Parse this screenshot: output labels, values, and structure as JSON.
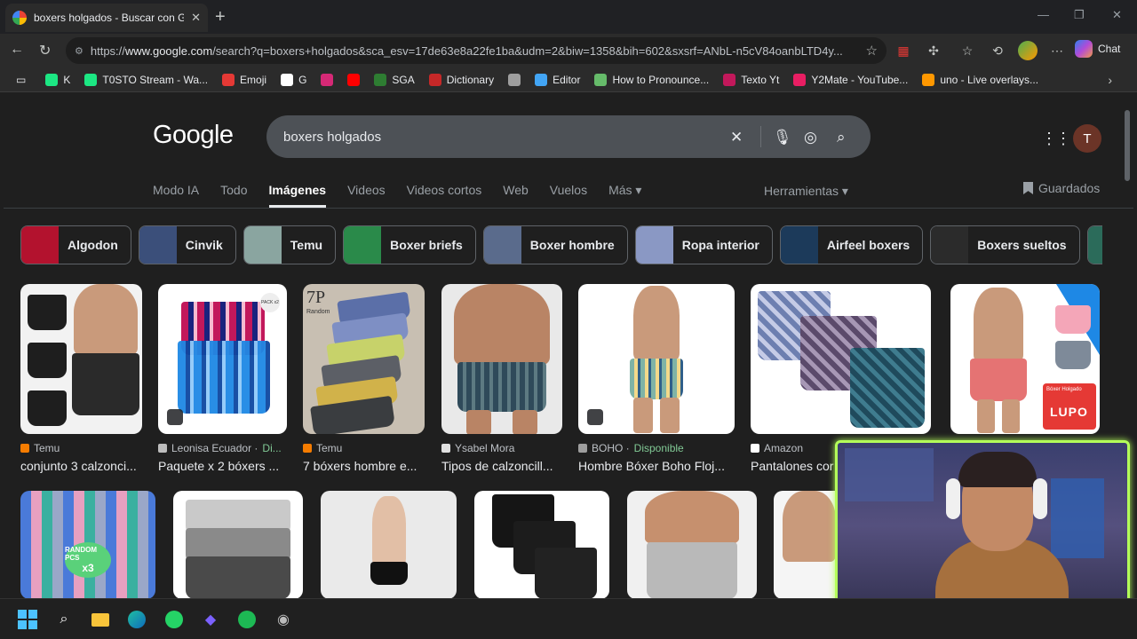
{
  "browser": {
    "tab_title": "boxers holgados - Buscar con Goo",
    "url_prefix": "https://",
    "url_host": "www.google.com",
    "url_rest": "/search?q=boxers+holgados&sca_esv=17de63e8a22fe1ba&udm=2&biw=1358&bih=602&sxsrf=ANbL-n5cV84oanbLTD4y...",
    "chat_label": "Chat"
  },
  "bookmarks": [
    {
      "label": "K",
      "color": "#1ce783"
    },
    {
      "label": "T0STO Stream - Wa...",
      "color": "#1ce783"
    },
    {
      "label": "Emoji",
      "color": "#e53935"
    },
    {
      "label": "G",
      "color": "#ffffff"
    },
    {
      "label": "",
      "color": "#d62976"
    },
    {
      "label": "",
      "color": "#ff0000"
    },
    {
      "label": "SGA",
      "color": "#2e7d32"
    },
    {
      "label": "Dictionary",
      "color": "#c62828"
    },
    {
      "label": "",
      "color": "#9e9e9e"
    },
    {
      "label": "Editor",
      "color": "#42a5f5"
    },
    {
      "label": "How to Pronounce...",
      "color": "#66bb6a"
    },
    {
      "label": "Texto Yt",
      "color": "#c2185b"
    },
    {
      "label": "Y2Mate - YouTube...",
      "color": "#e91e63"
    },
    {
      "label": "uno - Live overlays...",
      "color": "#ff9800"
    }
  ],
  "search": {
    "logo": "Google",
    "query": "boxers holgados",
    "profile_initial": "T"
  },
  "nav": {
    "tabs": [
      "Modo IA",
      "Todo",
      "Imágenes",
      "Videos",
      "Videos cortos",
      "Web",
      "Vuelos",
      "Más ▾"
    ],
    "active_index": 2,
    "tools": "Herramientas ▾",
    "saved": "Guardados"
  },
  "chips": [
    {
      "label": "Algodon",
      "color": "#b3122e"
    },
    {
      "label": "Cinvik",
      "color": "#3b4f7a"
    },
    {
      "label": "Temu",
      "color": "#8aa5a0"
    },
    {
      "label": "Boxer briefs",
      "color": "#2a8a4a"
    },
    {
      "label": "Boxer hombre",
      "color": "#5a6b8c"
    },
    {
      "label": "Ropa interior",
      "color": "#8a98c4"
    },
    {
      "label": "Airfeel boxers",
      "color": "#1c3a5a"
    },
    {
      "label": "Boxers sueltos",
      "color": "#2b2b2b"
    },
    {
      "label": "",
      "color": "#2b6b5a"
    }
  ],
  "results": [
    {
      "source": "Temu",
      "caption": "conjunto 3 calzonci...",
      "available": ""
    },
    {
      "source": "Leonisa Ecuador · ",
      "caption": "Paquete x 2 bóxers ...",
      "available": "Di..."
    },
    {
      "source": "Temu",
      "caption": "7 bóxers hombre e...",
      "available": ""
    },
    {
      "source": "Ysabel Mora",
      "caption": "Tipos de calzoncill...",
      "available": ""
    },
    {
      "source": "BOHO · ",
      "caption": "Hombre Bóxer Boho Floj...",
      "available": "Disponible"
    },
    {
      "source": "Amazon",
      "caption": "Pantalones cor",
      "available": ""
    },
    {
      "source": "",
      "caption": "",
      "available": ""
    }
  ],
  "image_text": {
    "pack_badge": "PACK x2",
    "seven_p": "7P",
    "random": "Random",
    "lupo": "LUPO",
    "boxer_holgado": "Bóxer Holgado",
    "random_pcs": "RANDOM PCS",
    "x3": "x3"
  },
  "colors": {
    "accent_green": "#81c995",
    "webcam_border": "#b4ff5a"
  }
}
